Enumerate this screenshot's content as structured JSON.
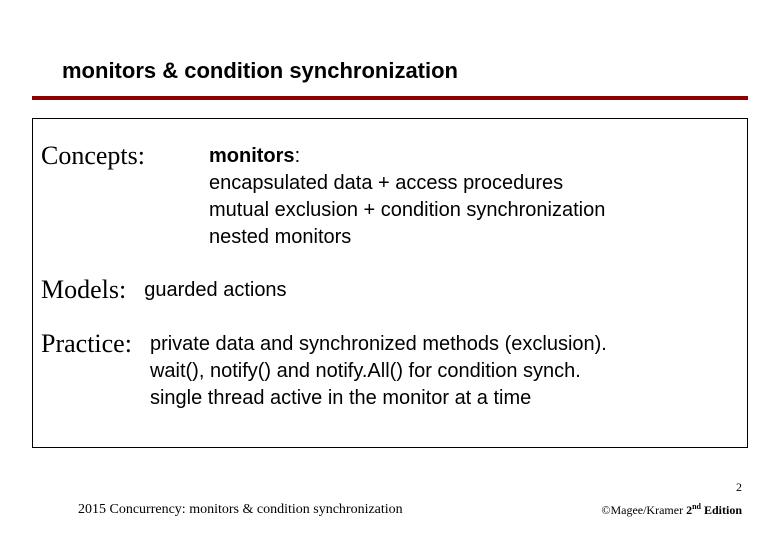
{
  "title": "monitors & condition synchronization",
  "concepts": {
    "label": "Concepts:",
    "heading": "monitors",
    "line1": "encapsulated data + access procedures",
    "line2": "mutual exclusion + condition synchronization",
    "line3": "nested monitors"
  },
  "models": {
    "label": "Models:",
    "text": "guarded actions"
  },
  "practice": {
    "label": "Practice:",
    "line1": "private data and synchronized methods (exclusion).",
    "line2": "wait(), notify() and notify.All() for condition synch.",
    "line3": "single thread active in the monitor at a time"
  },
  "slide_number": "2",
  "footer_left": "2015  Concurrency: monitors & condition synchronization",
  "footer_right_prefix": "©Magee/Kramer ",
  "footer_right_edition_num": "2",
  "footer_right_edition_sup": "nd",
  "footer_right_edition_word": " Edition"
}
